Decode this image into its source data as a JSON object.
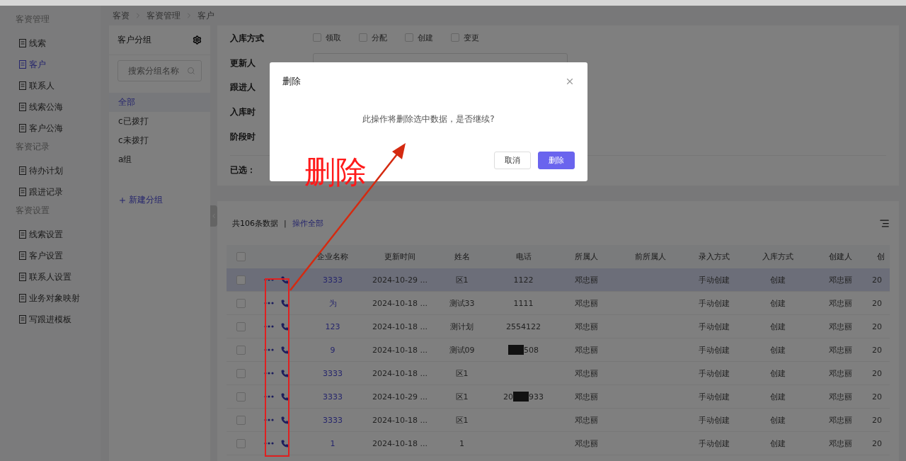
{
  "sidebar": {
    "sections": [
      {
        "title": "客资管理",
        "items": [
          {
            "label": "线索",
            "selected": false
          },
          {
            "label": "客户",
            "selected": true
          },
          {
            "label": "联系人",
            "selected": false
          },
          {
            "label": "线索公海",
            "selected": false
          },
          {
            "label": "客户公海",
            "selected": false
          }
        ]
      },
      {
        "title": "客资记录",
        "items": [
          {
            "label": "待办计划",
            "selected": false
          },
          {
            "label": "跟进记录",
            "selected": false
          }
        ]
      },
      {
        "title": "客资设置",
        "items": [
          {
            "label": "线索设置",
            "selected": false
          },
          {
            "label": "客户设置",
            "selected": false
          },
          {
            "label": "联系人设置",
            "selected": false
          },
          {
            "label": "业务对象映射",
            "selected": false
          },
          {
            "label": "写跟进模板",
            "selected": false
          }
        ]
      }
    ]
  },
  "breadcrumb": [
    "客资",
    "客资管理",
    "客户"
  ],
  "groups": {
    "title": "客户分组",
    "search_placeholder": "搜索分组名称",
    "items": [
      {
        "label": "全部",
        "selected": true
      },
      {
        "label": "c已拨打",
        "selected": false
      },
      {
        "label": "c未拨打",
        "selected": false
      },
      {
        "label": "a组",
        "selected": false
      }
    ],
    "add_label": "新建分组"
  },
  "filters": {
    "rows": [
      {
        "label": "入库方式",
        "kind": "checkboxes",
        "options": [
          {
            "label": "领取",
            "checked": false
          },
          {
            "label": "分配",
            "checked": false
          },
          {
            "label": "创建",
            "checked": false
          },
          {
            "label": "变更",
            "checked": false
          }
        ]
      },
      {
        "label": "更新人",
        "kind": "input"
      },
      {
        "label": "跟进人",
        "kind": "plain"
      },
      {
        "label": "入库时",
        "kind": "plain"
      },
      {
        "label": "阶段时",
        "kind": "plain"
      }
    ],
    "selected_label": "已选："
  },
  "table": {
    "all_checked": false,
    "count": "共106条数据",
    "separator": "|",
    "bulk_action": "操作全部",
    "columns": [
      "企业名称",
      "更新时间",
      "姓名",
      "电话",
      "所属人",
      "前所属人",
      "录入方式",
      "入库方式",
      "创建人",
      "创"
    ],
    "rows": [
      {
        "selected": true,
        "company": "3333",
        "updated": "2024-10-29 ...",
        "name": "区1",
        "phone": [
          "1122"
        ],
        "owner": "邓忠丽",
        "entry": "手动创建",
        "storage": "创建",
        "creator": "邓忠丽",
        "column_10": "20"
      },
      {
        "selected": false,
        "company": "为",
        "updated": "2024-10-18 ...",
        "name": "测试33",
        "phone": [
          "1111"
        ],
        "owner": "邓忠丽",
        "entry": "手动创建",
        "storage": "创建",
        "creator": "邓忠丽",
        "column_10": "20"
      },
      {
        "selected": false,
        "company": "123",
        "updated": "2024-10-18 ...",
        "name": "测计划",
        "phone": [
          "2554122"
        ],
        "owner": "邓忠丽",
        "entry": "手动创建",
        "storage": "创建",
        "creator": "邓忠丽",
        "column_10": "20"
      },
      {
        "selected": false,
        "company": "9",
        "updated": "2024-10-18 ...",
        "name": "测试09",
        "phone": [
          "508"
        ],
        "masked_lead": true,
        "owner": "邓忠丽",
        "entry": "手动创建",
        "storage": "创建",
        "creator": "邓忠丽",
        "column_10": "20"
      },
      {
        "selected": false,
        "company": "3333",
        "updated": "2024-10-18 ...",
        "name": "区1",
        "owner": "邓忠丽",
        "entry": "手动创建",
        "storage": "创建",
        "creator": "邓忠丽",
        "column_10": "20"
      },
      {
        "selected": false,
        "company": "3333",
        "updated": "2024-10-29 ...",
        "name": "区1",
        "phone": [
          "20",
          "933"
        ],
        "owner": "邓忠丽",
        "entry": "手动创建",
        "storage": "创建",
        "creator": "邓忠丽",
        "column_10": "20"
      },
      {
        "selected": false,
        "company": "3333",
        "updated": "2024-10-18 ...",
        "name": "区1",
        "owner": "邓忠丽",
        "entry": "手动创建",
        "storage": "创建",
        "creator": "邓忠丽",
        "column_10": "20"
      },
      {
        "selected": false,
        "company": "1",
        "updated": "2024-10-18 ...",
        "name": "1",
        "owner": "邓忠丽",
        "entry": "手动创建",
        "storage": "创建",
        "creator": "邓忠丽",
        "column_10": "20"
      }
    ]
  },
  "dialog": {
    "title": "删除",
    "message": "此操作将删除选中数据，是否继续?",
    "buttons": [
      {
        "label": "取消",
        "kind": "default"
      },
      {
        "label": "删除",
        "kind": "primary"
      }
    ]
  },
  "annotation": {
    "text": "删除"
  }
}
